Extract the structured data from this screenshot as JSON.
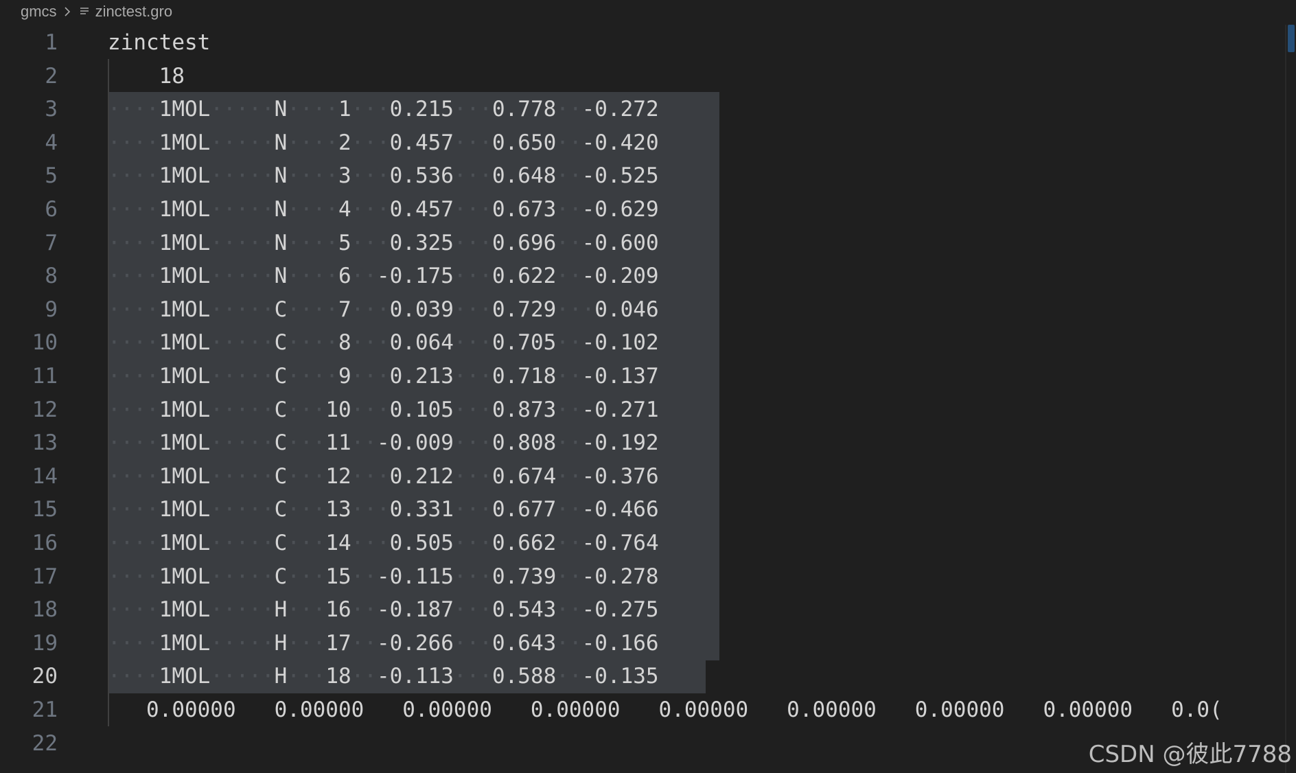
{
  "breadcrumb": {
    "folder": "gmcs",
    "file": "zinctest.gro"
  },
  "lines": [
    {
      "n": "1",
      "text": "zinctest"
    },
    {
      "n": "2",
      "text": "    18"
    },
    {
      "n": "3",
      "text": "····1MOL·····N····1···0.215···0.778··-0.272"
    },
    {
      "n": "4",
      "text": "····1MOL·····N····2···0.457···0.650··-0.420"
    },
    {
      "n": "5",
      "text": "····1MOL·····N····3···0.536···0.648··-0.525"
    },
    {
      "n": "6",
      "text": "····1MOL·····N····4···0.457···0.673··-0.629"
    },
    {
      "n": "7",
      "text": "····1MOL·····N····5···0.325···0.696··-0.600"
    },
    {
      "n": "8",
      "text": "····1MOL·····N····6··-0.175···0.622··-0.209"
    },
    {
      "n": "9",
      "text": "····1MOL·····C····7···0.039···0.729···0.046"
    },
    {
      "n": "10",
      "text": "····1MOL·····C····8···0.064···0.705··-0.102"
    },
    {
      "n": "11",
      "text": "····1MOL·····C····9···0.213···0.718··-0.137"
    },
    {
      "n": "12",
      "text": "····1MOL·····C···10···0.105···0.873··-0.271"
    },
    {
      "n": "13",
      "text": "····1MOL·····C···11··-0.009···0.808··-0.192"
    },
    {
      "n": "14",
      "text": "····1MOL·····C···12···0.212···0.674··-0.376"
    },
    {
      "n": "15",
      "text": "····1MOL·····C···13···0.331···0.677··-0.466"
    },
    {
      "n": "16",
      "text": "····1MOL·····C···14···0.505···0.662··-0.764"
    },
    {
      "n": "17",
      "text": "····1MOL·····C···15··-0.115···0.739··-0.278"
    },
    {
      "n": "18",
      "text": "····1MOL·····H···16··-0.187···0.543··-0.275"
    },
    {
      "n": "19",
      "text": "····1MOL·····H···17··-0.266···0.643··-0.166"
    },
    {
      "n": "20",
      "text": "····1MOL·····H···18··-0.113···0.588··-0.135"
    },
    {
      "n": "21",
      "text": "   0.00000   0.00000   0.00000   0.00000   0.00000   0.00000   0.00000   0.00000   0.0("
    },
    {
      "n": "22",
      "text": ""
    }
  ],
  "active_line": "20",
  "watermark": "CSDN @彼此7788",
  "colors": {
    "background": "#1f1f1f",
    "selection": "#3a3d41",
    "line_number": "#6e7681",
    "text": "#d4d4d4"
  }
}
